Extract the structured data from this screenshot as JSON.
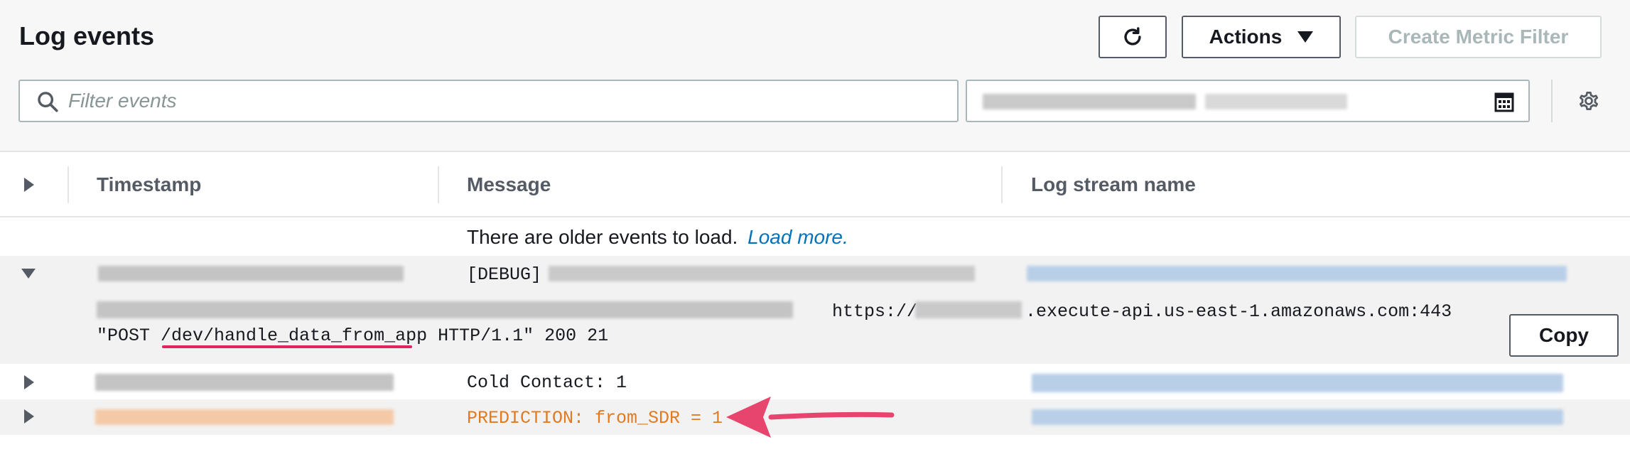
{
  "panel": {
    "title": "Log events",
    "refresh_icon": "refresh-icon",
    "actions_label": "Actions",
    "create_metric_filter_label": "Create Metric Filter"
  },
  "filter": {
    "placeholder": "Filter events",
    "value": ""
  },
  "table": {
    "headers": [
      "Timestamp",
      "Message",
      "Log stream name"
    ],
    "older_events_text": "There are older events to load.",
    "load_more_label": "Load more.",
    "copy_label": "Copy",
    "rows": [
      {
        "expanded": true,
        "message_prefix": "[DEBUG]",
        "detail_line1_suffix": ".execute-api.us-east-1.amazonaws.com:443",
        "detail_url_prefix": "https://",
        "detail_line2_part1": "\"POST ",
        "detail_line2_path": "/dev/handle_data_from_app",
        "detail_line2_part2": " HTTP/1.1\" 200 21"
      },
      {
        "expanded": false,
        "message": "Cold Contact: 1"
      },
      {
        "expanded": false,
        "message": "PREDICTION: from_SDR = 1",
        "highlighted": true
      }
    ]
  },
  "colors": {
    "accent_link": "#0073bb",
    "prediction_text": "#e07b22",
    "annotation": "#e0245e"
  }
}
